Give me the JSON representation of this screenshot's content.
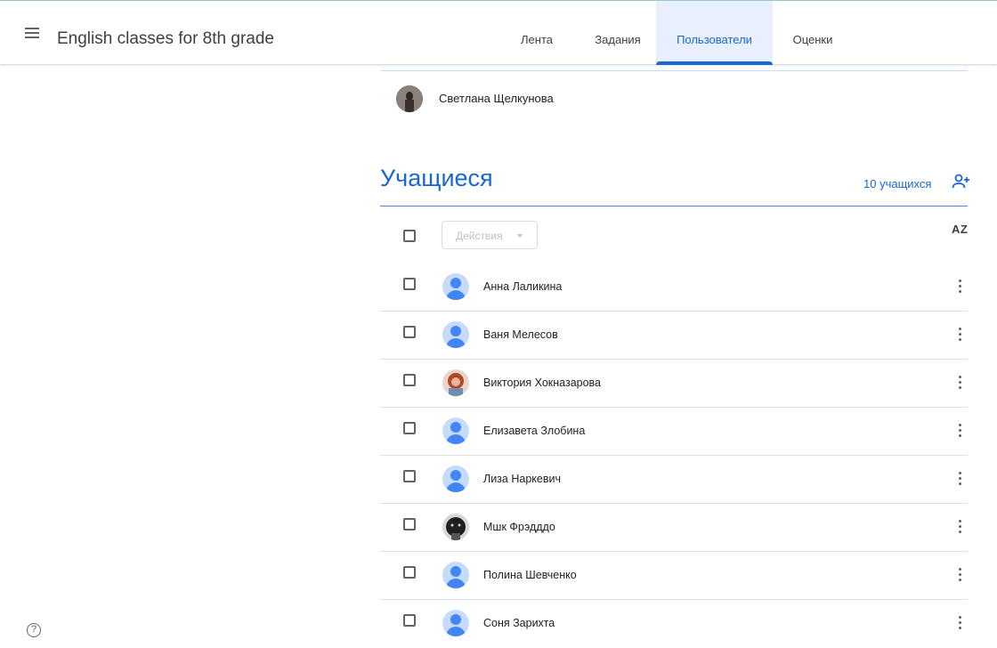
{
  "header": {
    "class_title": "English classes for 8th grade",
    "tabs": [
      {
        "label": "Лента",
        "active": false
      },
      {
        "label": "Задания",
        "active": false
      },
      {
        "label": "Пользователи",
        "active": true
      },
      {
        "label": "Оценки",
        "active": false
      }
    ]
  },
  "teachers": [
    {
      "name": "Светлана Щелкунова",
      "avatar": "photo"
    }
  ],
  "students": {
    "title": "Учащиеся",
    "count_label": "10 учащихся",
    "actions_label": "Действия",
    "sort_icon_text": "AZ",
    "list": [
      {
        "name": "Анна Лаликина",
        "avatar": "default"
      },
      {
        "name": "Ваня Мелесов",
        "avatar": "default"
      },
      {
        "name": "Виктория Хокназарова",
        "avatar": "photo"
      },
      {
        "name": "Елизавета Злобина",
        "avatar": "default"
      },
      {
        "name": "Лиза Наркевич",
        "avatar": "default"
      },
      {
        "name": "Мшк Фрэдддо",
        "avatar": "photo"
      },
      {
        "name": "Полина Шевченко",
        "avatar": "default"
      },
      {
        "name": "Соня Зарихта",
        "avatar": "default"
      }
    ]
  },
  "colors": {
    "accent": "#1967d2",
    "active_tab_bg": "#e8f0fe"
  }
}
